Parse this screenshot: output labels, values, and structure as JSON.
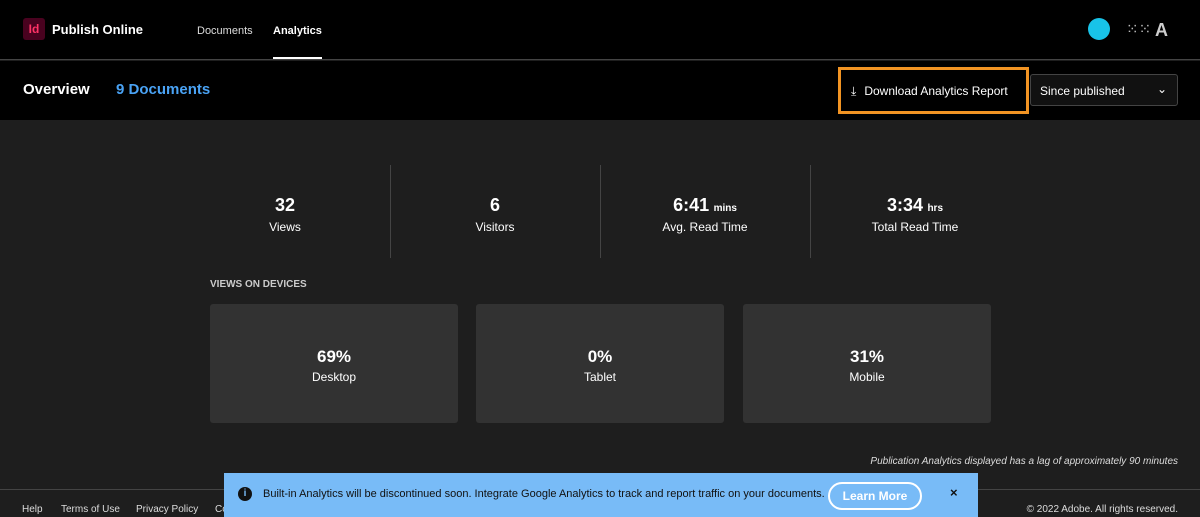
{
  "header": {
    "logo": "Id",
    "app_name": "Publish Online",
    "nav": [
      "Documents",
      "Analytics"
    ]
  },
  "subheader": {
    "title": "Overview",
    "documents": "9 Documents",
    "download_label": "Download Analytics Report",
    "range": "Since published"
  },
  "stats": [
    {
      "value": "32",
      "unit": "",
      "label": "Views"
    },
    {
      "value": "6",
      "unit": "",
      "label": "Visitors"
    },
    {
      "value": "6:41",
      "unit": "mins",
      "label": "Avg. Read Time"
    },
    {
      "value": "3:34",
      "unit": "hrs",
      "label": "Total Read Time"
    }
  ],
  "devices": {
    "title": "VIEWS ON DEVICES",
    "items": [
      {
        "value": "69%",
        "label": "Desktop"
      },
      {
        "value": "0%",
        "label": "Tablet"
      },
      {
        "value": "31%",
        "label": "Mobile"
      }
    ]
  },
  "note": "Publication Analytics displayed has a lag of approximately 90 minutes",
  "footer": {
    "links": [
      "Help",
      "Terms of Use",
      "Privacy Policy",
      "Co"
    ],
    "copyright": "© 2022 Adobe. All rights reserved."
  },
  "banner": {
    "text": "Built-in Analytics will be discontinued soon. Integrate Google Analytics to track and report traffic on your documents.",
    "button": "Learn More",
    "close": "×"
  }
}
